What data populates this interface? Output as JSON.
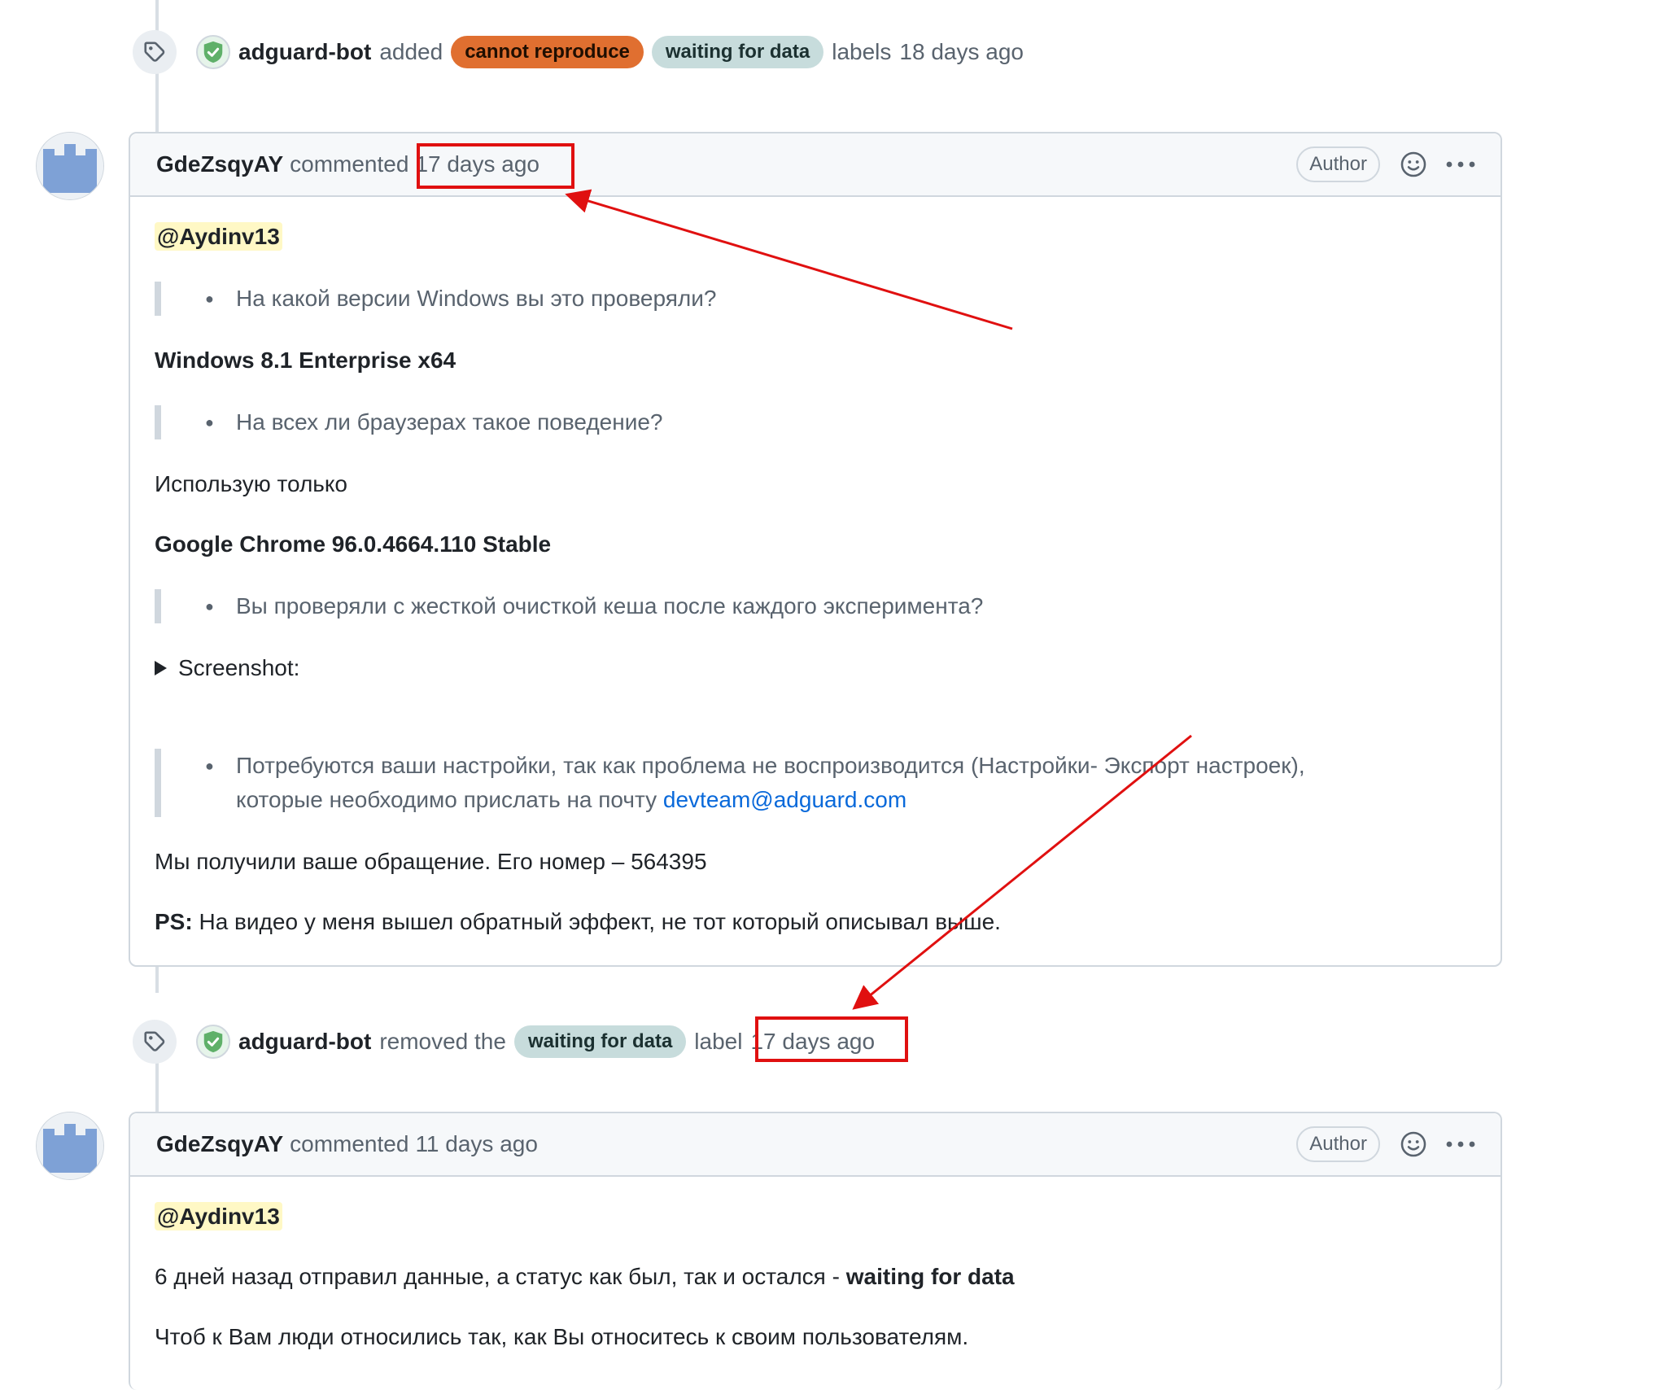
{
  "events": [
    {
      "actor": "adguard-bot",
      "verb": "added",
      "labels": [
        {
          "text": "cannot reproduce",
          "color": "#e06f30"
        },
        {
          "text": "waiting for data",
          "color": "#c7dcdc"
        }
      ],
      "suffix": "labels",
      "time": "18 days ago"
    },
    {
      "actor": "adguard-bot",
      "verb": "removed the",
      "labels": [
        {
          "text": "waiting for data",
          "color": "#c7dcdc"
        }
      ],
      "suffix": "label",
      "time": "17 days ago"
    }
  ],
  "comments": [
    {
      "author": "GdeZsqyAY",
      "verb": "commented",
      "time": "17 days ago",
      "badge": "Author",
      "mention": "@Aydinv13",
      "q1": "На какой версии Windows вы это проверяли?",
      "a1": "Windows 8.1 Enterprise x64",
      "q2": "На всех ли браузерах такое поведение?",
      "a2": "Использую только",
      "a3": "Google Chrome 96.0.4664.110 Stable",
      "q3": "Вы проверяли с жесткой очисткой кеша после каждого эксперимента?",
      "summary": "Screenshot:",
      "q4_line1": "Потребуются ваши настройки, так как проблема не воспроизводится (Настройки- Экспорт настроек),",
      "q4_line2": "которые необходимо прислать на почту",
      "q4_email": "devteam@adguard.com",
      "p1": "Мы получили ваше обращение. Его номер – 564395",
      "ps_label": "PS:",
      "ps_text": "На видео у меня вышел обратный эффект, не тот который описывал выше."
    },
    {
      "author": "GdeZsqyAY",
      "verb": "commented",
      "time": "11 days ago",
      "badge": "Author",
      "mention": "@Aydinv13",
      "p1_text": "6 дней назад отправил данные, а статус как был, так и остался -",
      "p1_bold": "waiting for data",
      "p2": "Чтоб к Вам люди относились так, как Вы относитесь к своим пользователям."
    }
  ],
  "colors": {
    "annotation": "#e01010",
    "avatar": "#7ea1d6",
    "link": "#0969da",
    "mention_bg": "#fff8c5"
  },
  "icons": [
    "tag-icon",
    "verified-check-icon",
    "smiley-icon",
    "kebab-menu-icon",
    "disclosure-triangle-icon"
  ]
}
